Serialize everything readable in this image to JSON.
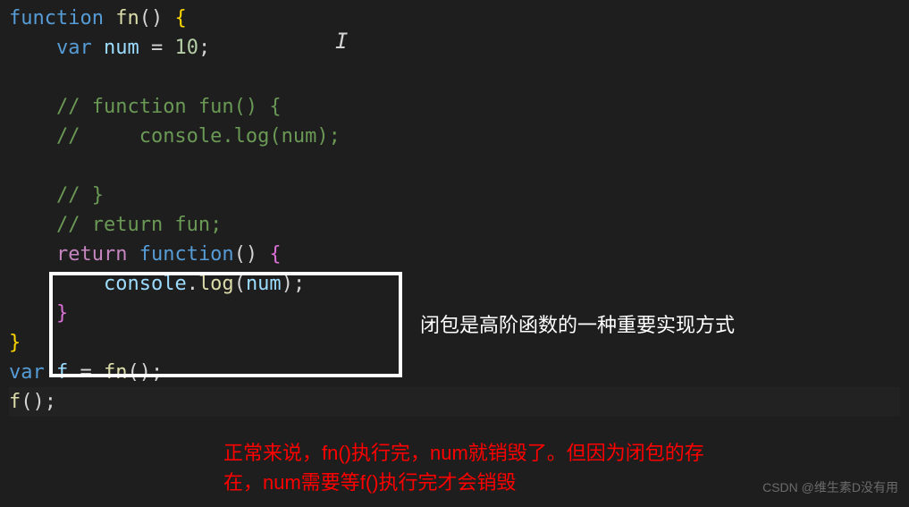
{
  "code": {
    "line1": {
      "kw_function": "function",
      "fn_name": "fn",
      "parens": "()",
      "brace": " {"
    },
    "line2": {
      "indent": "    ",
      "kw_var": "var",
      "var_name": " num",
      "equals": " = ",
      "number": "10",
      "semi": ";"
    },
    "line3": "",
    "line4": {
      "indent": "    ",
      "comment": "// function fun() {"
    },
    "line5": {
      "indent": "    ",
      "comment": "//     console.log(num);"
    },
    "line6": "",
    "line7": {
      "indent": "    ",
      "comment": "// }"
    },
    "line8": {
      "indent": "    ",
      "comment": "// return fun;"
    },
    "line9": {
      "indent": "    ",
      "kw_return": "return",
      "kw_function": " function",
      "parens": "()",
      "brace": " {"
    },
    "line10": {
      "indent": "        ",
      "obj": "console",
      "dot": ".",
      "method": "log",
      "lparen": "(",
      "arg": "num",
      "rparen": ")",
      "semi": ";"
    },
    "line11": {
      "indent": "    ",
      "brace": "}"
    },
    "line12": {
      "brace": "}"
    },
    "line13": {
      "kw_var": "var",
      "var_name": " f",
      "equals": " = ",
      "fn_name": "fn",
      "parens": "()",
      "semi": ";"
    },
    "line14": {
      "fn_name": "f",
      "parens": "()",
      "semi": ";"
    }
  },
  "annotations": {
    "right_text": "闭包是高阶函数的一种重要实现方式",
    "bottom_text_1": "正常来说，fn()执行完，num就销毁了。但因为闭包的存",
    "bottom_text_2": "在，num需要等f()执行完才会销毁"
  },
  "watermark": "CSDN @维生素D没有用",
  "cursor_glyph": "I"
}
